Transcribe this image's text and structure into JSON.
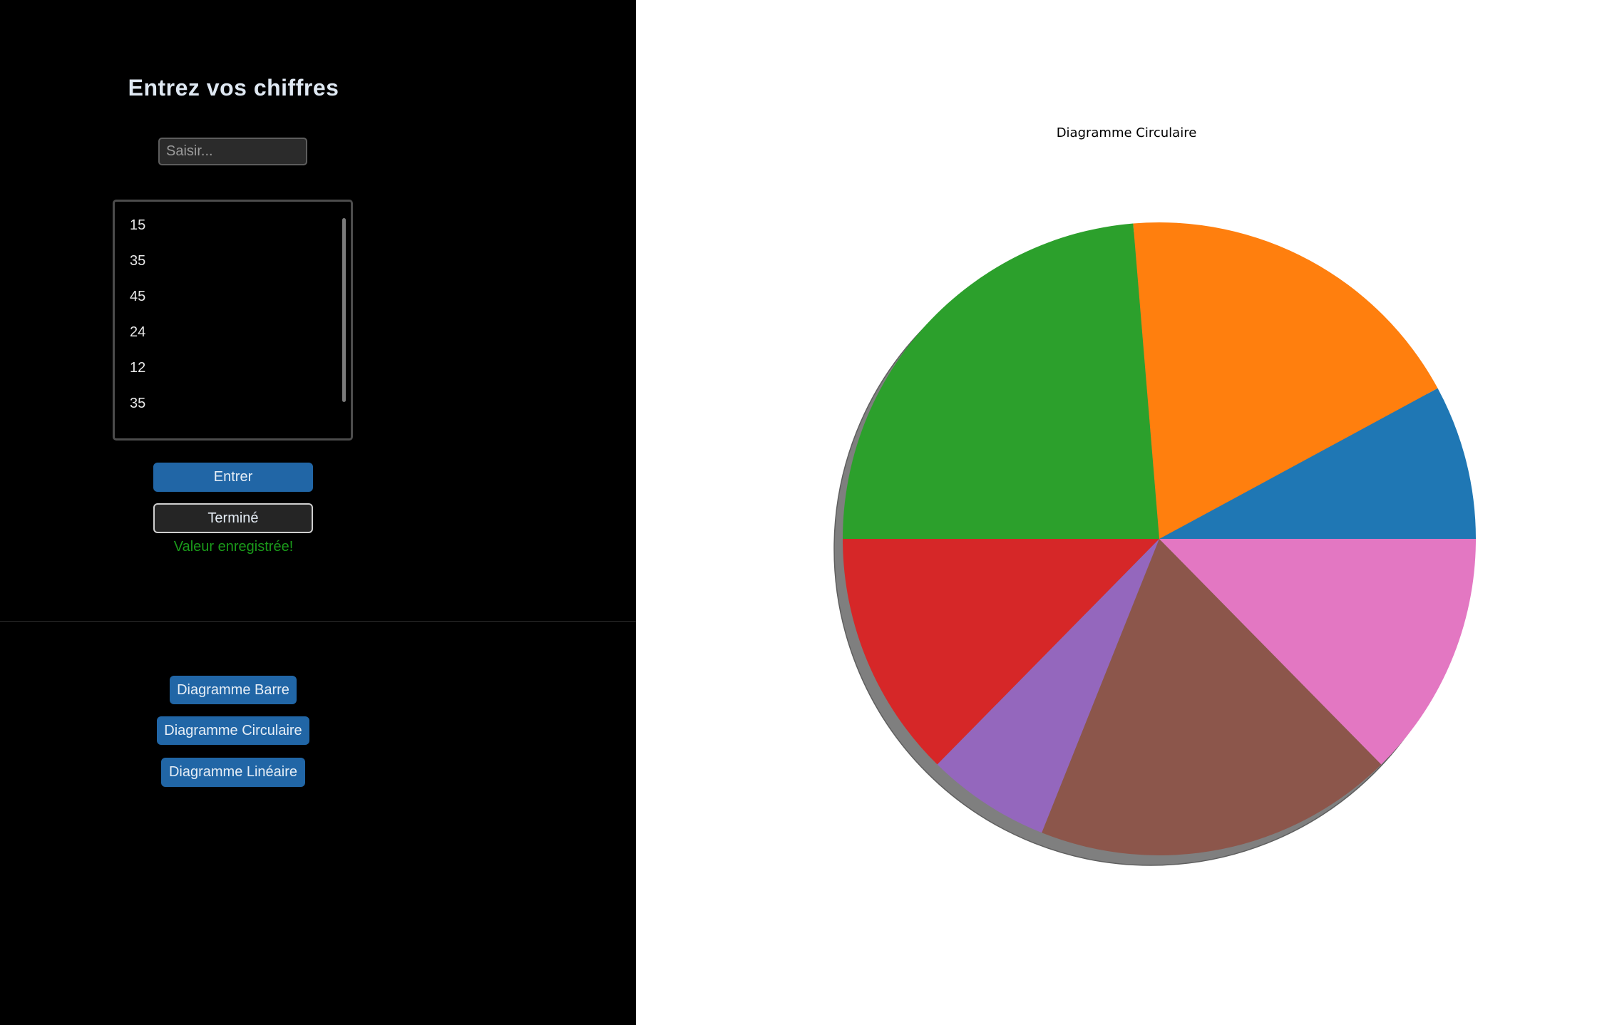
{
  "input_panel": {
    "heading": "Entrez vos chiffres",
    "input_placeholder": "Saisir...",
    "input_value": "",
    "values": [
      "15",
      "35",
      "45",
      "24",
      "12",
      "35"
    ],
    "enter_label": "Entrer",
    "done_label": "Terminé",
    "status_message": "Valeur enregistrée!"
  },
  "chart_buttons": {
    "bar": "Diagramme Barre",
    "pie": "Diagramme Circulaire",
    "line": "Diagramme Linéaire"
  },
  "colors": {
    "left_panel_background": "#000000",
    "button_blue": "#2166a6",
    "status_green": "#1a9a1a"
  },
  "chart_data": {
    "type": "pie",
    "title": "Diagramme Circulaire",
    "values": [
      15,
      35,
      45,
      24,
      12,
      35,
      24
    ],
    "colors": [
      "#1f77b4",
      "#ff7f0e",
      "#2ca02c",
      "#d62728",
      "#9467bd",
      "#8c564b",
      "#e377c2"
    ],
    "start_angle": 0,
    "direction": "counterclockwise",
    "shadow": true,
    "legend": "none"
  }
}
